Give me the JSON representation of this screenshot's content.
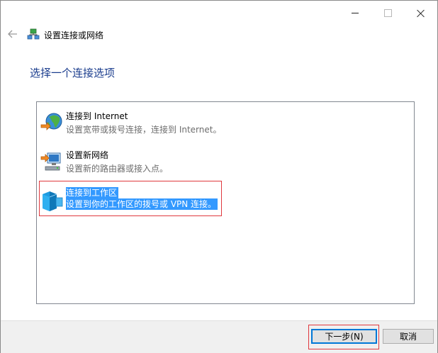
{
  "window": {
    "minimize_icon": "minimize-icon",
    "maximize_icon": "maximize-icon",
    "close_icon": "close-icon"
  },
  "nav": {
    "back_icon": "back-arrow-icon",
    "title": "设置连接或网络",
    "icon": "network-setup-icon"
  },
  "heading": "选择一个连接选项",
  "options": [
    {
      "title": "连接到 Internet",
      "description": "设置宽带或拨号连接，连接到 Internet。",
      "icon": "globe-internet-icon",
      "selected": false
    },
    {
      "title": "设置新网络",
      "description": "设置新的路由器或接入点。",
      "icon": "new-network-icon",
      "selected": false
    },
    {
      "title": "连接到工作区",
      "description": "设置到你的工作区的拨号或 VPN 连接。",
      "icon": "workplace-icon",
      "selected": true
    }
  ],
  "buttons": {
    "next": "下一步(N)",
    "cancel": "取消"
  },
  "colors": {
    "heading": "#1a3c8d",
    "selection": "#3399ff",
    "annotation": "#e0393e",
    "accent": "#0078d7"
  }
}
